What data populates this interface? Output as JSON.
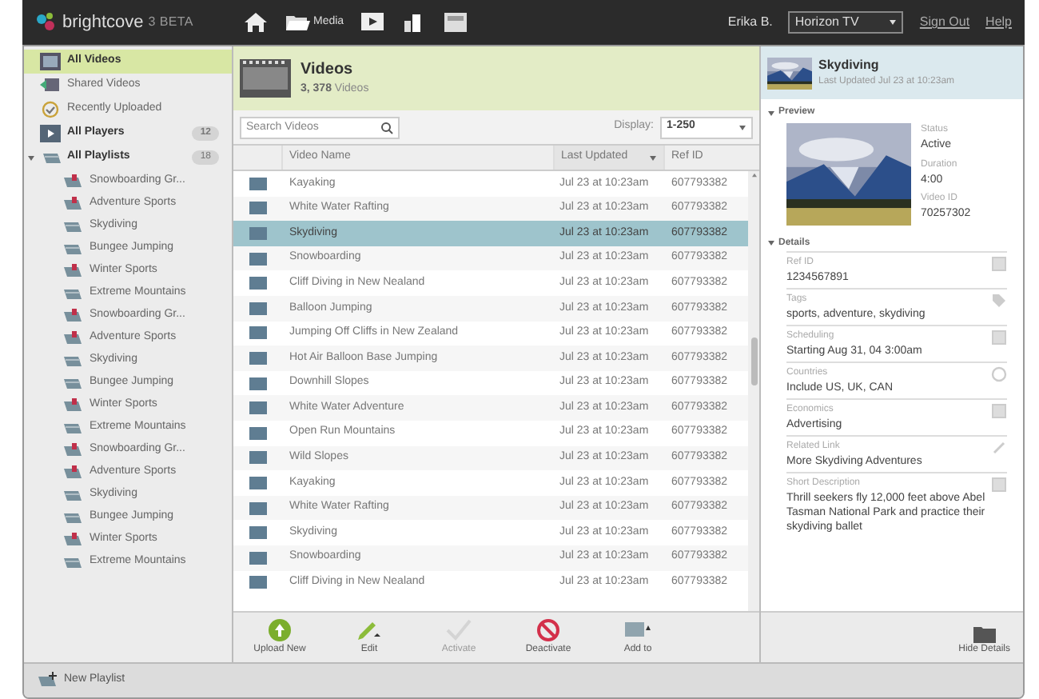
{
  "topbar": {
    "logo": "brightcove",
    "logo_suffix": "3 BETA",
    "nav": [
      {
        "kind": "home"
      },
      {
        "kind": "media",
        "label": "Media"
      },
      {
        "kind": "player"
      },
      {
        "kind": "analytics"
      },
      {
        "kind": "settings"
      }
    ],
    "user": "Erika B.",
    "account": "Horizon TV",
    "links": [
      "Sign Out",
      "Help"
    ]
  },
  "sidebar": {
    "items": [
      {
        "label": "All Videos",
        "kind": "videos",
        "selected": true,
        "bold": true
      },
      {
        "label": "Shared Videos",
        "kind": "shared",
        "selected": false,
        "bold": false
      },
      {
        "label": "Recently Uploaded",
        "kind": "recent",
        "selected": false,
        "bold": false
      },
      {
        "label": "All Players",
        "kind": "players",
        "selected": false,
        "bold": true,
        "count": "12"
      }
    ],
    "playlists": {
      "label": "All Playlists",
      "count": "18",
      "expanded": true,
      "children": [
        {
          "label": "Snowboarding Gr...",
          "kind": "manual"
        },
        {
          "label": "Adventure Sports",
          "kind": "manual"
        },
        {
          "label": "Skydiving",
          "kind": "smart"
        },
        {
          "label": "Bungee Jumping",
          "kind": "smart"
        },
        {
          "label": "Winter Sports",
          "kind": "manual"
        },
        {
          "label": "Extreme Mountains",
          "kind": "smart"
        },
        {
          "label": "Snowboarding Gr...",
          "kind": "manual"
        },
        {
          "label": "Adventure Sports",
          "kind": "manual"
        },
        {
          "label": "Skydiving",
          "kind": "smart"
        },
        {
          "label": "Bungee Jumping",
          "kind": "smart"
        },
        {
          "label": "Winter Sports",
          "kind": "manual"
        },
        {
          "label": "Extreme Mountains",
          "kind": "smart"
        },
        {
          "label": "Snowboarding Gr...",
          "kind": "manual"
        },
        {
          "label": "Adventure Sports",
          "kind": "manual"
        },
        {
          "label": "Skydiving",
          "kind": "smart"
        },
        {
          "label": "Bungee Jumping",
          "kind": "smart"
        },
        {
          "label": "Winter Sports",
          "kind": "manual"
        },
        {
          "label": "Extreme Mountains",
          "kind": "smart"
        }
      ]
    },
    "new_playlist": "New Playlist"
  },
  "videos": {
    "title": "Videos",
    "count": "3, 378",
    "count_label": "Videos",
    "search": {
      "placeholder": "Search Videos"
    },
    "display_label": "Display:",
    "display_value": "1-250",
    "columns": [
      "Video Name",
      "Last Updated",
      "Ref ID"
    ],
    "rows": [
      {
        "name": "Kayaking",
        "updated": "Jul 23 at 10:23am",
        "ref": "607793382",
        "selected": false
      },
      {
        "name": "White Water Rafting",
        "updated": "Jul 23 at 10:23am",
        "ref": "607793382",
        "selected": false
      },
      {
        "name": "Skydiving",
        "updated": "Jul 23 at 10:23am",
        "ref": "607793382",
        "selected": true
      },
      {
        "name": "Snowboarding",
        "updated": "Jul 23 at 10:23am",
        "ref": "607793382",
        "selected": false
      },
      {
        "name": "Cliff Diving in New Nealand",
        "updated": "Jul 23 at 10:23am",
        "ref": "607793382",
        "selected": false
      },
      {
        "name": "Balloon Jumping",
        "updated": "Jul 23 at 10:23am",
        "ref": "607793382",
        "selected": false
      },
      {
        "name": "Jumping Off Cliffs in New Zealand",
        "updated": "Jul 23 at 10:23am",
        "ref": "607793382",
        "selected": false
      },
      {
        "name": "Hot Air Balloon Base Jumping",
        "updated": "Jul 23 at 10:23am",
        "ref": "607793382",
        "selected": false
      },
      {
        "name": "Downhill Slopes",
        "updated": "Jul 23 at 10:23am",
        "ref": "607793382",
        "selected": false
      },
      {
        "name": "White Water Adventure",
        "updated": "Jul 23 at 10:23am",
        "ref": "607793382",
        "selected": false
      },
      {
        "name": "Open Run Mountains",
        "updated": "Jul 23 at 10:23am",
        "ref": "607793382",
        "selected": false
      },
      {
        "name": "Wild Slopes",
        "updated": "Jul 23 at 10:23am",
        "ref": "607793382",
        "selected": false
      },
      {
        "name": "Kayaking",
        "updated": "Jul 23 at 10:23am",
        "ref": "607793382",
        "selected": false
      },
      {
        "name": "White Water Rafting",
        "updated": "Jul 23 at 10:23am",
        "ref": "607793382",
        "selected": false
      },
      {
        "name": "Skydiving",
        "updated": "Jul 23 at 10:23am",
        "ref": "607793382",
        "selected": false
      },
      {
        "name": "Snowboarding",
        "updated": "Jul 23 at 10:23am",
        "ref": "607793382",
        "selected": false
      },
      {
        "name": "Cliff Diving in New Nealand",
        "updated": "Jul 23 at 10:23am",
        "ref": "607793382",
        "selected": false
      }
    ],
    "actions": [
      {
        "kind": "upload",
        "label": "Upload New",
        "disabled": false
      },
      {
        "kind": "edit",
        "label": "Edit",
        "disabled": false
      },
      {
        "kind": "activate",
        "label": "Activate",
        "disabled": true
      },
      {
        "kind": "deactivate",
        "label": "Deactivate",
        "disabled": false
      },
      {
        "kind": "add",
        "label": "Add to",
        "disabled": false
      }
    ]
  },
  "details": {
    "title": "Skydiving",
    "subtitle": "Last Updated Jul 23 at 10:23am",
    "preview_label": "Preview",
    "preview_fields": [
      {
        "label": "Status",
        "value": "Active"
      },
      {
        "label": "Duration",
        "value": "4:00"
      },
      {
        "label": "Video ID",
        "value": "70257302"
      }
    ],
    "details_label": "Details",
    "fields": [
      {
        "kind": "refid",
        "label": "Ref ID",
        "value": "1234567891"
      },
      {
        "kind": "tags",
        "label": "Tags",
        "value": "sports, adventure, skydiving"
      },
      {
        "kind": "schedule",
        "label": "Scheduling",
        "value": "Starting Aug 31, 04 3:00am"
      },
      {
        "kind": "countries",
        "label": "Countries",
        "value": "Include US, UK, CAN"
      },
      {
        "kind": "economics",
        "label": "Economics",
        "value": "Advertising"
      },
      {
        "kind": "link",
        "label": "Related Link",
        "value": "More Skydiving Adventures"
      },
      {
        "kind": "description",
        "label": "Short Description",
        "value": "Thrill seekers fly 12,000 feet above Abel Tasman National Park and practice their skydiving ballet"
      }
    ],
    "hide_label": "Hide Details"
  }
}
